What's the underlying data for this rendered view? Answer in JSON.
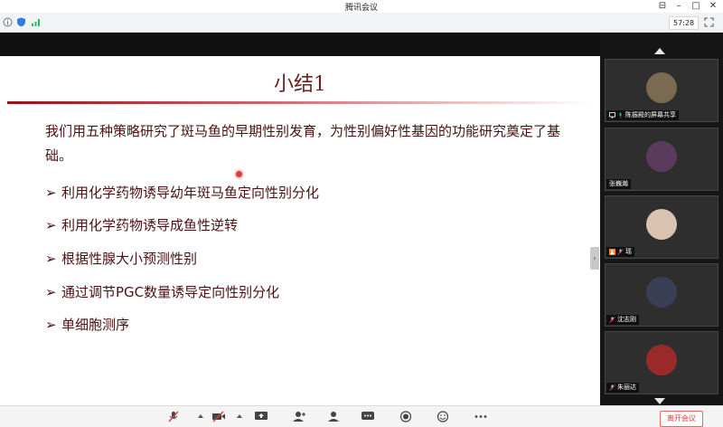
{
  "window": {
    "title": "腾讯会议"
  },
  "statusbar": {
    "timer": "57:28"
  },
  "slide": {
    "title": "小结1",
    "intro": "我们用五种策略研究了斑马鱼的早期性别发育，为性别偏好性基因的功能研究奠定了基础。",
    "bullets": [
      "利用化学药物诱导幼年斑马鱼定向性别分化",
      "利用化学药物诱导成鱼性逆转",
      "根据性腺大小预测性别",
      "通过调节PGC数量诱导定向性别分化",
      "单细胞测序"
    ]
  },
  "participants": [
    {
      "name": "陈振殿的屏幕共享",
      "avatar_color": "#7a6a52"
    },
    {
      "name": "张巍瀚",
      "avatar_color": "#5a3b5e"
    },
    {
      "name": "瑶",
      "avatar_color": "#d9c2b0"
    },
    {
      "name": "沈志刚",
      "avatar_color": "#3a3f55"
    },
    {
      "name": "朱丽达",
      "avatar_color": "#9a2a2a"
    }
  ],
  "toolbar": {
    "leave_label": "离开会议"
  },
  "colors": {
    "accent_red": "#9b0d14",
    "text_dark_red": "#4a1212",
    "leave_red": "#e03b3b"
  }
}
